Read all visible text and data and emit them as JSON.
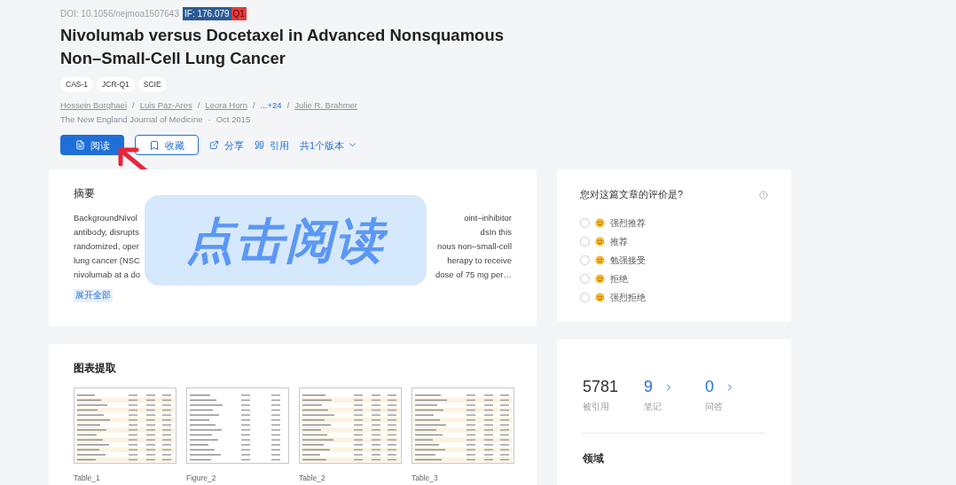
{
  "doi": "DOI: 10.1056/nejmoa1507643",
  "impact": {
    "factor": "IF: 176.079",
    "quartile": "Q1"
  },
  "title": "Nivolumab versus Docetaxel in Advanced Nonsquamous Non–Small-Cell Lung Cancer",
  "tags": [
    "CAS-1",
    "JCR-Q1",
    "SCIE"
  ],
  "authors": [
    {
      "name": "Hossein Borghaei",
      "kind": "author"
    },
    {
      "name": "Luis Paz-Ares",
      "kind": "author"
    },
    {
      "name": "Leora Horn",
      "kind": "author"
    },
    {
      "name": "...+24",
      "kind": "more"
    },
    {
      "name": "Julie R. Brahmer",
      "kind": "author"
    }
  ],
  "author_separator": "/",
  "journal": "The New England Journal of Medicine",
  "date_separator": "·",
  "date": "Oct 2015",
  "actions": [
    {
      "label": "阅读",
      "kind": "primary"
    },
    {
      "label": "收藏",
      "kind": "outline"
    },
    {
      "label": "分享",
      "kind": "share"
    },
    {
      "label": "引用",
      "kind": "cite"
    },
    {
      "label": "共1个版本",
      "kind": "versions"
    }
  ],
  "abstract": {
    "heading": "摘要",
    "lines": [
      {
        "left": "BackgroundNivol",
        "right": "oint–inhibitor"
      },
      {
        "left": "antibody, disrupts",
        "right": "dsIn this"
      },
      {
        "left": "randomized, oper",
        "right": "nous non–small-cell"
      },
      {
        "left": "lung cancer (NSC",
        "right": "herapy to receive"
      },
      {
        "left": "nivolumab at a do",
        "right": "dose of 75 mg per…"
      }
    ],
    "expand": "展开全部"
  },
  "overlay": "点击阅读",
  "figures": {
    "heading": "图表提取",
    "items": [
      "Table_1",
      "Figure_2",
      "Table_2",
      "Table_3"
    ]
  },
  "rating": {
    "question": "您对这篇文章的评价是?",
    "options": [
      {
        "label": "强烈推荐",
        "selected": false
      },
      {
        "label": "推荐",
        "selected": false
      },
      {
        "label": "勉强接受",
        "selected": false
      },
      {
        "label": "拒绝",
        "selected": false
      },
      {
        "label": "强烈拒绝",
        "selected": false
      }
    ]
  },
  "stats": [
    {
      "value": "5781",
      "label": "被引用",
      "link": false
    },
    {
      "value": "9",
      "label": "笔记",
      "link": true
    },
    {
      "value": "0",
      "label": "问答",
      "link": true
    }
  ],
  "field_heading": "领域"
}
